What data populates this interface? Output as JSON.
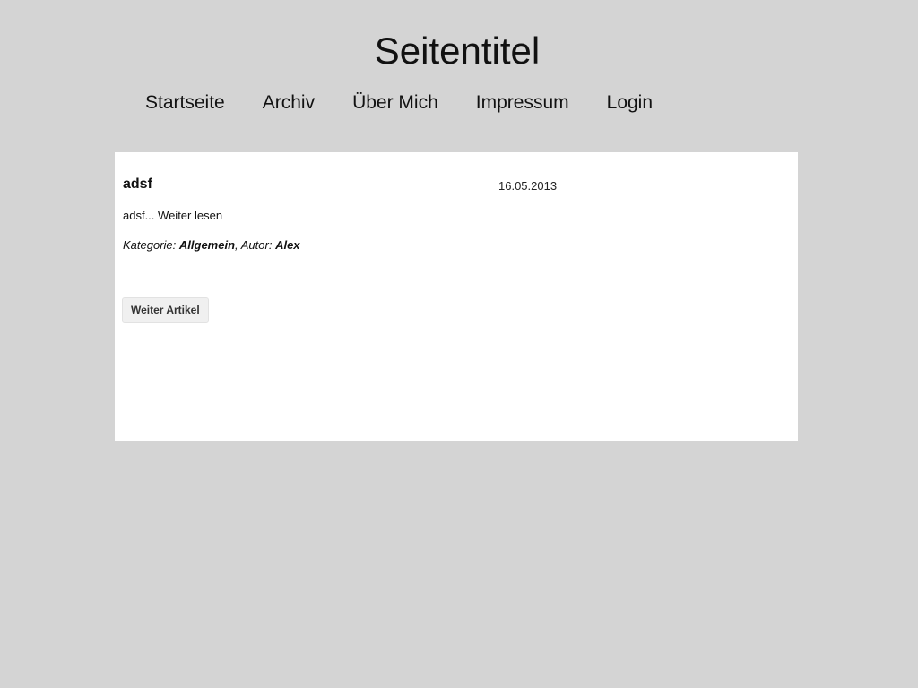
{
  "site": {
    "title": "Seitentitel"
  },
  "nav": {
    "items": [
      {
        "label": "Startseite"
      },
      {
        "label": "Archiv"
      },
      {
        "label": "Über Mich"
      },
      {
        "label": "Impressum"
      },
      {
        "label": "Login"
      }
    ]
  },
  "post": {
    "title": "adsf",
    "date": "16.05.2013",
    "excerpt": "adsf...",
    "read_more": "Weiter lesen",
    "category_label": "Kategorie:",
    "category": "Allgemein",
    "author_label": "Autor:",
    "author": "Alex"
  },
  "pager": {
    "next_label": "Weiter Artikel"
  },
  "colors": {
    "page_background": "#d4d4d4",
    "panel_background": "#ffffff",
    "button_background": "#f0f0f0"
  }
}
